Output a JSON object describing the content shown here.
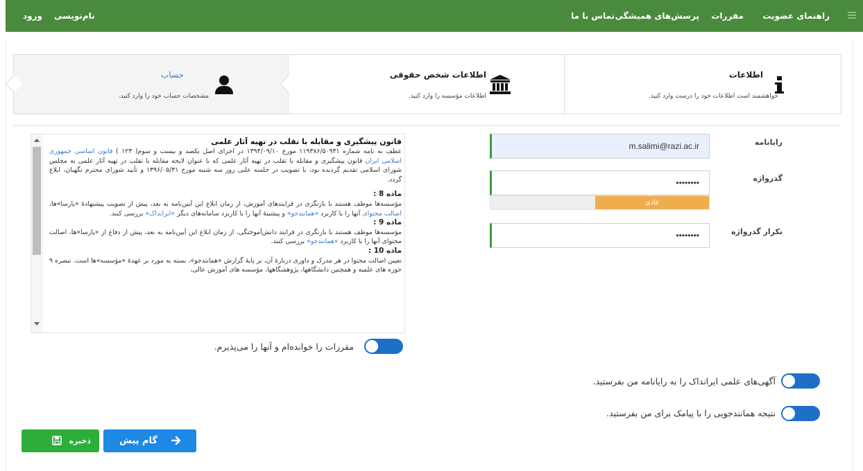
{
  "navbar": {
    "items": [
      {
        "label": "راهنمای عضویت"
      },
      {
        "label": "مقررات"
      },
      {
        "label": "پرسش‌های همیشگی"
      },
      {
        "label": "تماس با ما"
      }
    ],
    "signup_label": "نام‌نویسی",
    "login_label": "ورود"
  },
  "steps": [
    {
      "title": "اطلاعات",
      "desc": "خواهشمند است اطلاعات خود را درست وارد کنید.",
      "icon": "info-icon"
    },
    {
      "title": "اطلاعات شخص حقوقی",
      "desc": "اطلاعات مؤسسه را وارد کنید.",
      "icon": "institution-icon"
    },
    {
      "title": "حساب",
      "desc": "مشخصات حساب خود را وارد کنید.",
      "icon": "user-icon"
    }
  ],
  "form": {
    "email_label": "رایانامه",
    "email_value": "m.salimi@razi.ac.ir",
    "password_label": "گذرواژه",
    "password_value": "••••••••",
    "strength_label": "عادی",
    "strength_percent": 52,
    "confirm_label": "تکرار گذرواژه",
    "confirm_value": "••••••••"
  },
  "rules": {
    "title": "قانون پیشگیری و مقابله با تقلب در تهیه آثار علمی",
    "intro_a": "عطف به نامه شماره ۱۱۹۳۸۶/۵۰۹۳۱ مورخ ۱۳۹۴/۰۹/۱۰ در اجرای اصل یکصد و بیست و سوم( ۱۲۳ ) ",
    "intro_link": "قانون اساسی جمهوری اسلامی ایران",
    "intro_b": " قانون پیشگیری و مقابله با تقلب در تهیه آثار علمی که با عنوان لایحه مقابله با تقلب در تهیه آثار علمی به مجلس شورای اسلامی تقدیم گردیده بود، با تصویب در جلسه علنی روز سه شنبه مورخ ۱۳۹۶/۰۵/۳۱ و تأیید شورای محترم نگهبان، ابلاغ گردد.",
    "art8_title": "ماده 8 :",
    "art8_a": "مؤسسه‌ها موظف هستند با بازنگری در فرایندهای آموزش، از زمان ابلاغ این آیین‌نامه به بعد، پیش از تصویب پیشنهادهٔ «پارسا»ها، ",
    "art8_link1": "اصالت محتوای",
    "art8_b": " آنها را با کاربرد ",
    "art8_link2": "«همانندجو»",
    "art8_c": " و پیشینهٔ آنها را با کاربرد سامانه‌های دیگر ",
    "art8_link3": "«ایرانداک»",
    "art8_d": " بررسی کنند.",
    "art9_title": "ماده 9 :",
    "art9_a": "مؤسسه‌ها موظف هستند با بازنگری در فرایند دانش‌آموختگی، از زمان ابلاغ این آیین‌نامه به بعد، پیش از دفاع از «پارسا»ها، اصالت محتوای آنها را با کاربرد ",
    "art9_link": "«همانندجو»",
    "art9_b": " بررسی کنند.",
    "art10_title": "ماده 10 :",
    "art10_a": "تعیین اصالت محتوا در هر مدرک و داوری دربارهٔ آن، بر پایهٔ گزارش «همانندجو»، بسته به مورد بر عهدهٔ «مؤسسه»ها است. تبصره ۹ حوزه های علمیه و همچنین دانشگاهها، پژوهشگاهها، مؤسسه های آموزش عالی،"
  },
  "toggles": {
    "accept_rules": "مقررات را خوانده‌ام و آنها را می‌پذیرم.",
    "irandoc_ads": "آگهی‌های علمی ایرانداک را به رایانامه من بفرستید.",
    "sms_result": "نتیجه همانندجویی را با پیامک برای من بفرستید."
  },
  "buttons": {
    "next": "گام پیش",
    "save": "ذخیره"
  },
  "colors": {
    "navbar": "#4a8a3c",
    "primary": "#1e6fc8",
    "save": "#2dad3a",
    "strength": "#f0ad4e",
    "link": "#3b7dc8"
  }
}
